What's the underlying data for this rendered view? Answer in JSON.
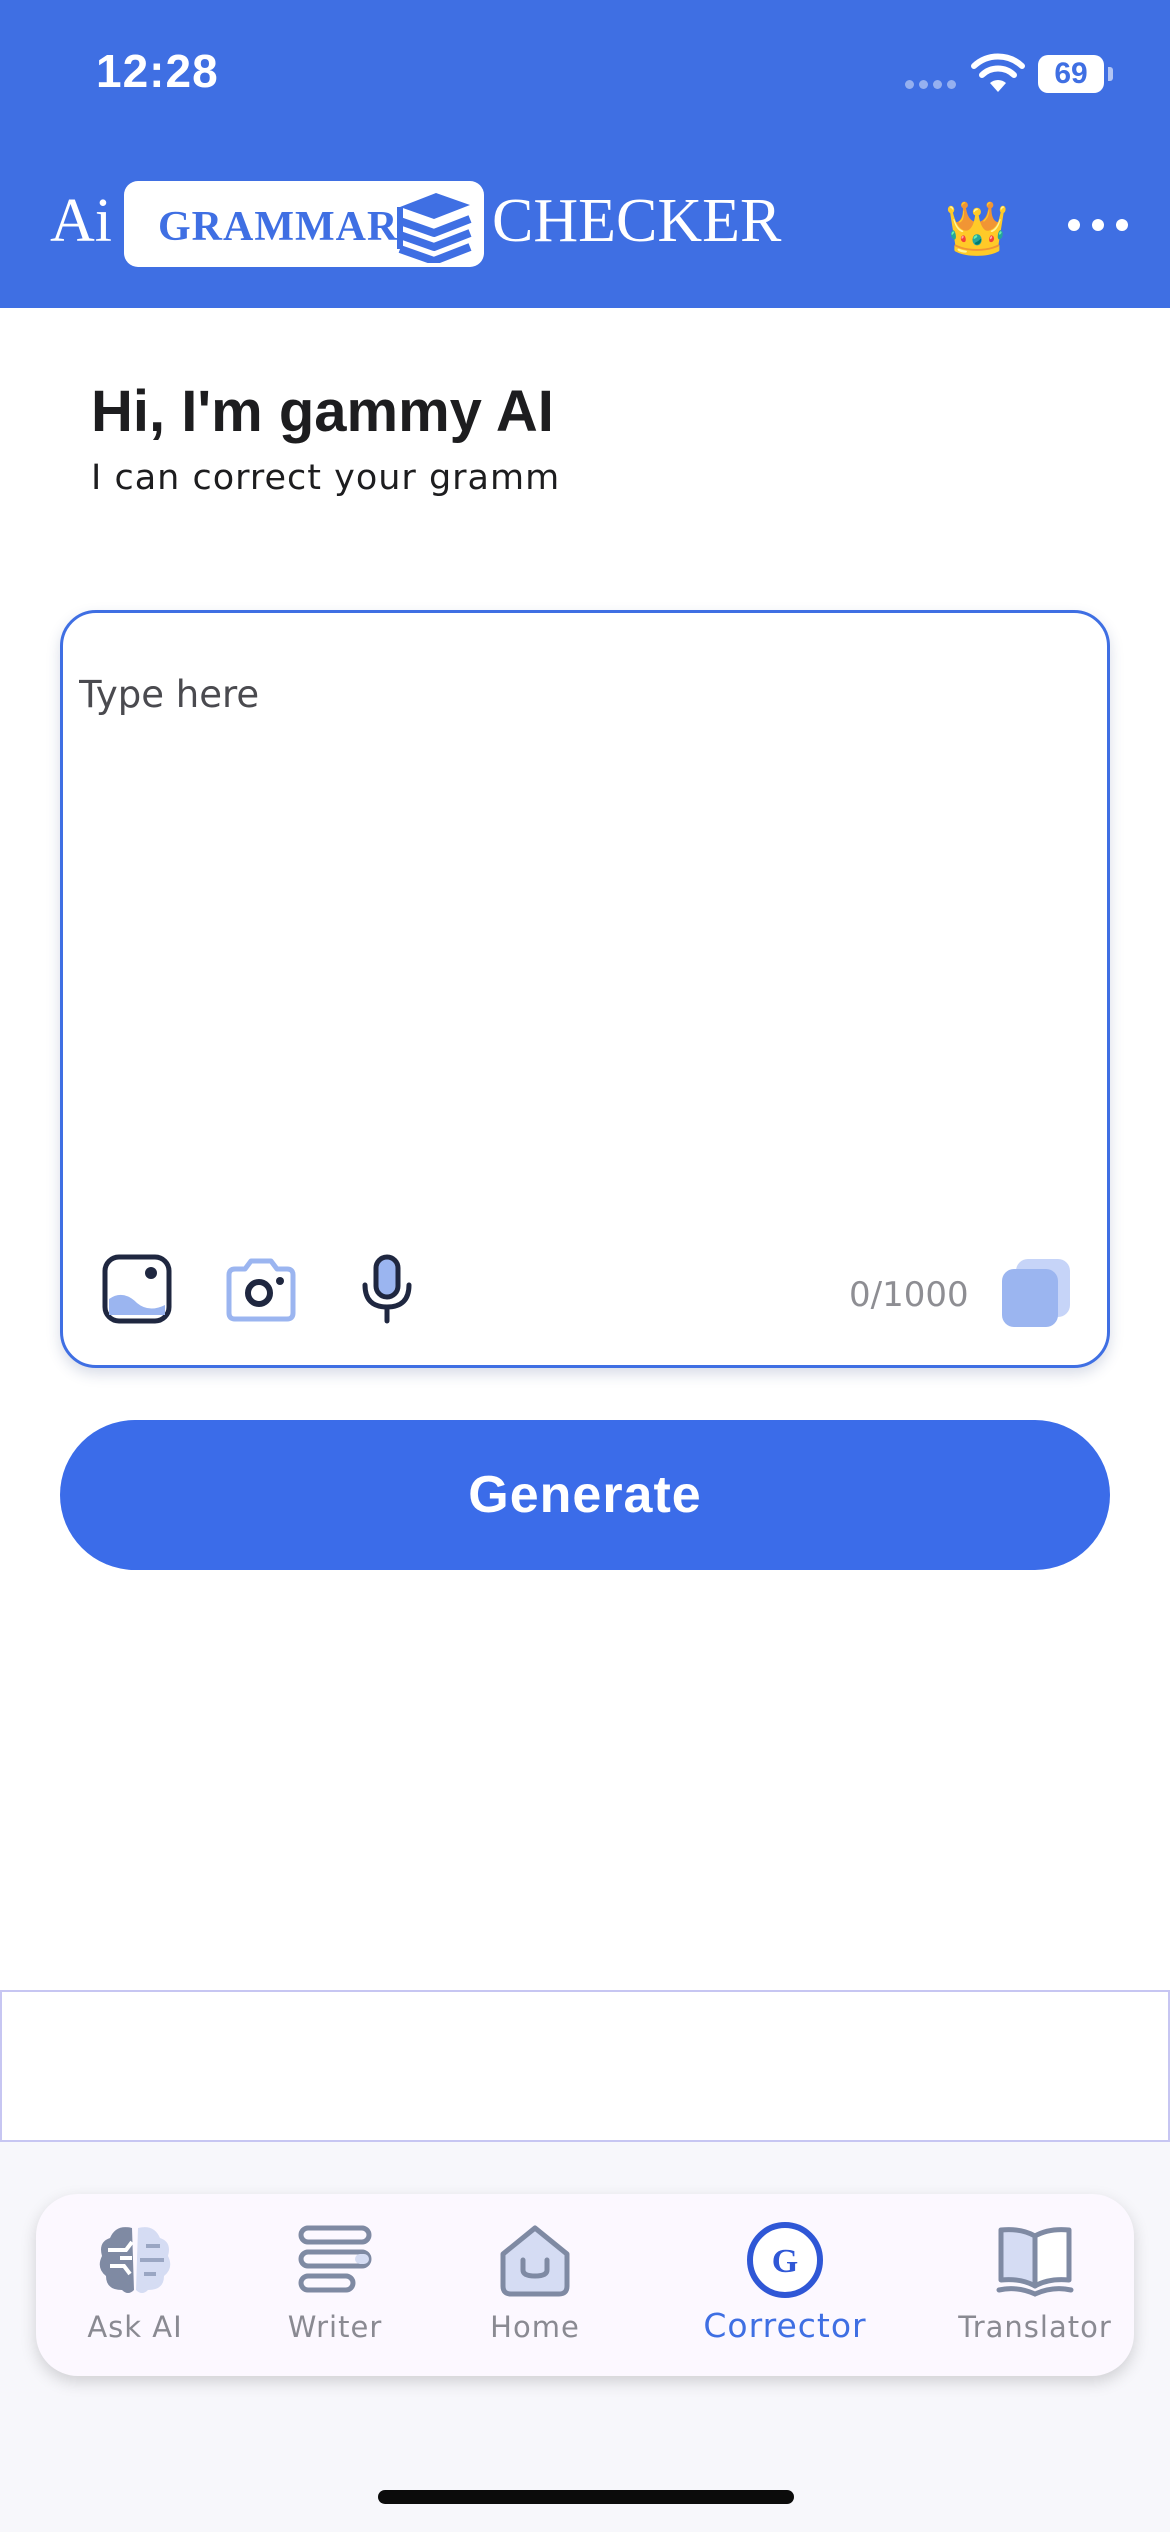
{
  "status_bar": {
    "time": "12:28",
    "battery": "69"
  },
  "header": {
    "logo": {
      "prefix": "Ai",
      "boxed": "GRAMMAR",
      "suffix": "CHECKER"
    },
    "premium_icon": "crown-icon",
    "more_icon": "more-horizontal-icon"
  },
  "greeting": {
    "title": "Hi, I'm gammy AI",
    "subtitle": "I can correct your gramm"
  },
  "editor": {
    "placeholder": "Type here",
    "value": "",
    "char_count": "0/1000",
    "tools": [
      "image-icon",
      "camera-icon",
      "microphone-icon"
    ],
    "copy_icon": "copy-icon"
  },
  "generate_button": {
    "label": "Generate"
  },
  "tabs": [
    {
      "label": "Ask AI",
      "icon": "brain-icon",
      "active": false
    },
    {
      "label": "Writer",
      "icon": "writer-lines-icon",
      "active": false
    },
    {
      "label": "Home",
      "icon": "home-icon",
      "active": false
    },
    {
      "label": "Corrector",
      "icon": "corrector-g-icon",
      "active": true
    },
    {
      "label": "Translator",
      "icon": "book-icon",
      "active": false
    }
  ],
  "colors": {
    "brand": "#3f6fe3",
    "button": "#3b6ce9",
    "text": "#1d1d1f",
    "muted": "#8e8e93",
    "icon_light": "#9bb5f0",
    "icon_dark": "#1f2740"
  }
}
